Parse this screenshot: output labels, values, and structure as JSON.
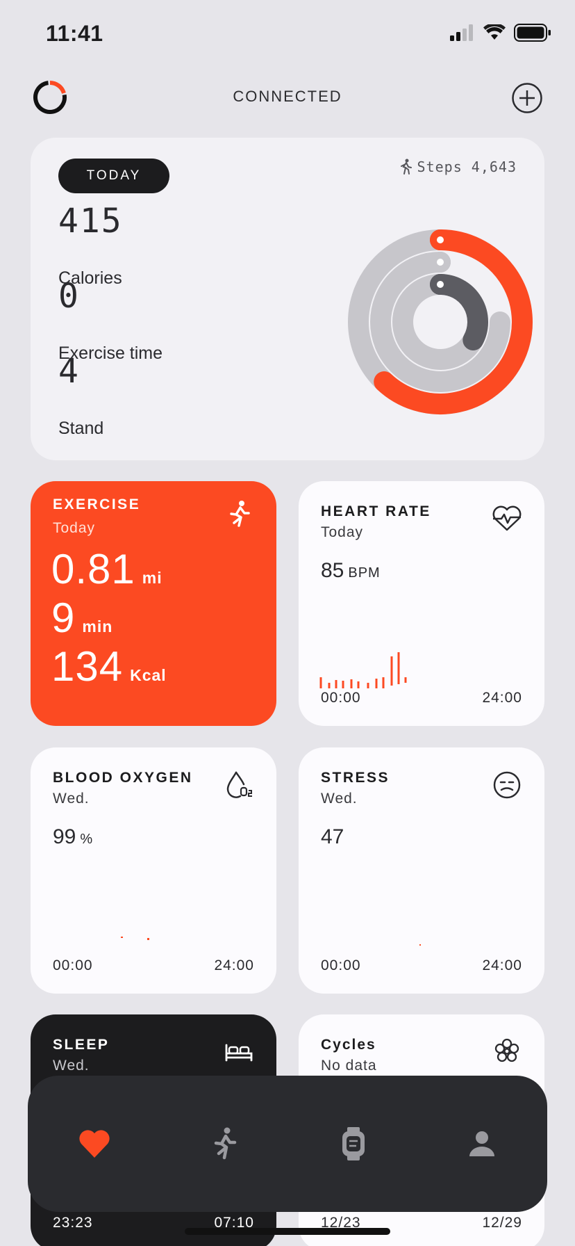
{
  "status_bar": {
    "time": "11:41"
  },
  "header": {
    "title": "CONNECTED"
  },
  "today": {
    "pill": "TODAY",
    "steps": "Steps 4,643",
    "calories_value": "415",
    "calories_label": "Calories",
    "exercise_value": "0",
    "exercise_label": "Exercise time",
    "stand_value": "4",
    "stand_label": "Stand",
    "rings": [
      {
        "name": "calories",
        "color": "#fc4a22",
        "fraction": 0.62
      },
      {
        "name": "exercise",
        "color": "#c7c6cb",
        "fraction": 0.0
      },
      {
        "name": "stand",
        "color": "#5c5c62",
        "fraction": 0.33
      }
    ]
  },
  "exercise": {
    "title": "EXERCISE",
    "sub": "Today",
    "distance": "0.81",
    "distance_unit": "mi",
    "duration": "9",
    "duration_unit": "min",
    "energy": "134",
    "energy_unit": "Kcal"
  },
  "heart_rate": {
    "title": "HEART RATE",
    "sub": "Today",
    "value": "85",
    "unit": "BPM",
    "axis_start": "00:00",
    "axis_end": "24:00",
    "color": "#fc4a22"
  },
  "blood_oxygen": {
    "title": "BLOOD OXYGEN",
    "sub": "Wed.",
    "value": "99",
    "unit": "%",
    "axis_start": "00:00",
    "axis_end": "24:00"
  },
  "stress": {
    "title": "STRESS",
    "sub": "Wed.",
    "value": "47",
    "axis_start": "00:00",
    "axis_end": "24:00"
  },
  "sleep": {
    "title": "SLEEP",
    "sub": "Wed.",
    "axis_start": "23:23",
    "axis_end": "07:10"
  },
  "cycles": {
    "title": "Cycles",
    "sub": "No data",
    "axis_start": "12/23",
    "axis_end": "12/29"
  },
  "tabs": [
    {
      "name": "health",
      "icon": "heart-icon",
      "active": true
    },
    {
      "name": "workout",
      "icon": "running-icon",
      "active": false
    },
    {
      "name": "device",
      "icon": "watch-icon",
      "active": false
    },
    {
      "name": "profile",
      "icon": "person-icon",
      "active": false
    }
  ]
}
